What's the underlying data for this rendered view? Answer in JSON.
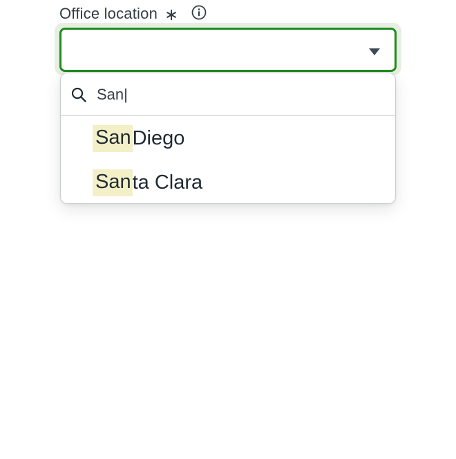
{
  "field": {
    "label": "Office location",
    "required_mark": "∗",
    "info_icon": "info-circle-icon",
    "selected_value": "",
    "caret_icon": "caret-down-icon",
    "accent_color": "#1f8a1f"
  },
  "search": {
    "icon": "search-icon",
    "value": "San|"
  },
  "options": [
    {
      "match": "San",
      "rest": " Diego"
    },
    {
      "match": "San",
      "rest": "ta Clara"
    }
  ],
  "highlight_color": "#f3f0c8"
}
